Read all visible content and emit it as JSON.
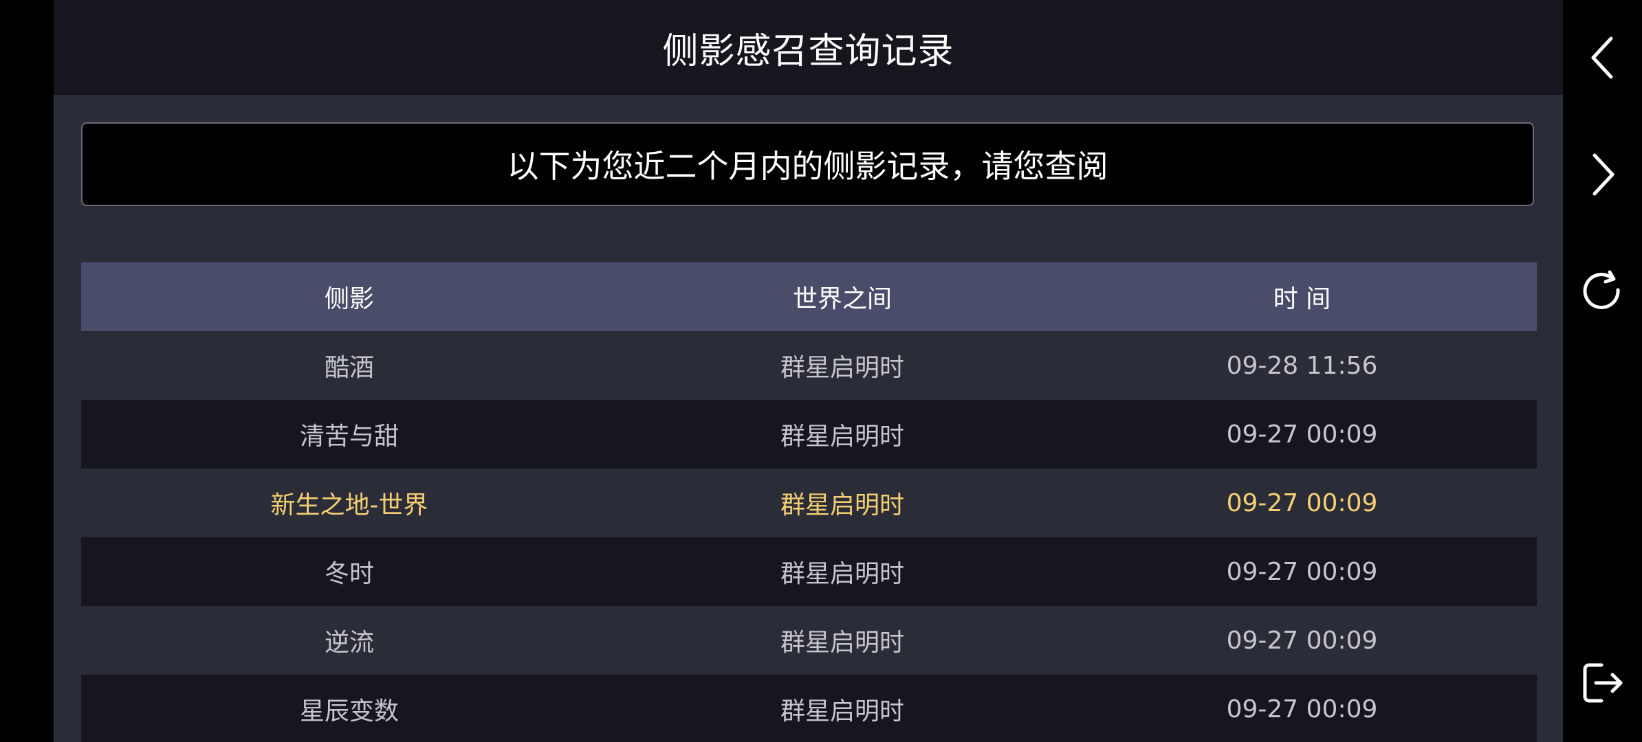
{
  "header": {
    "title": "侧影感召查询记录"
  },
  "notice": {
    "text": "以下为您近二个月内的侧影记录，请您查阅"
  },
  "table": {
    "columns": [
      "侧影",
      "世界之间",
      "时 间"
    ],
    "rows": [
      {
        "name": "酷酒",
        "world": "群星启明时",
        "time": "09-28 11:56",
        "highlight": false
      },
      {
        "name": "清苦与甜",
        "world": "群星启明时",
        "time": "09-27 00:09",
        "highlight": false
      },
      {
        "name": "新生之地-世界",
        "world": "群星启明时",
        "time": "09-27 00:09",
        "highlight": true
      },
      {
        "name": "冬时",
        "world": "群星启明时",
        "time": "09-27 00:09",
        "highlight": false
      },
      {
        "name": "逆流",
        "world": "群星启明时",
        "time": "09-27 00:09",
        "highlight": false
      },
      {
        "name": "星辰变数",
        "world": "群星启明时",
        "time": "09-27 00:09",
        "highlight": false
      }
    ]
  },
  "sidebar": {
    "icons": [
      "chevron-left-icon",
      "chevron-right-icon",
      "refresh-icon",
      "logout-icon"
    ]
  },
  "colors": {
    "header_bg": "#15161e",
    "body_bg": "#2a2d38",
    "table_head_bg": "#4a4d6a",
    "highlight_text": "#f6cf72",
    "normal_text": "#c6c7cc"
  }
}
